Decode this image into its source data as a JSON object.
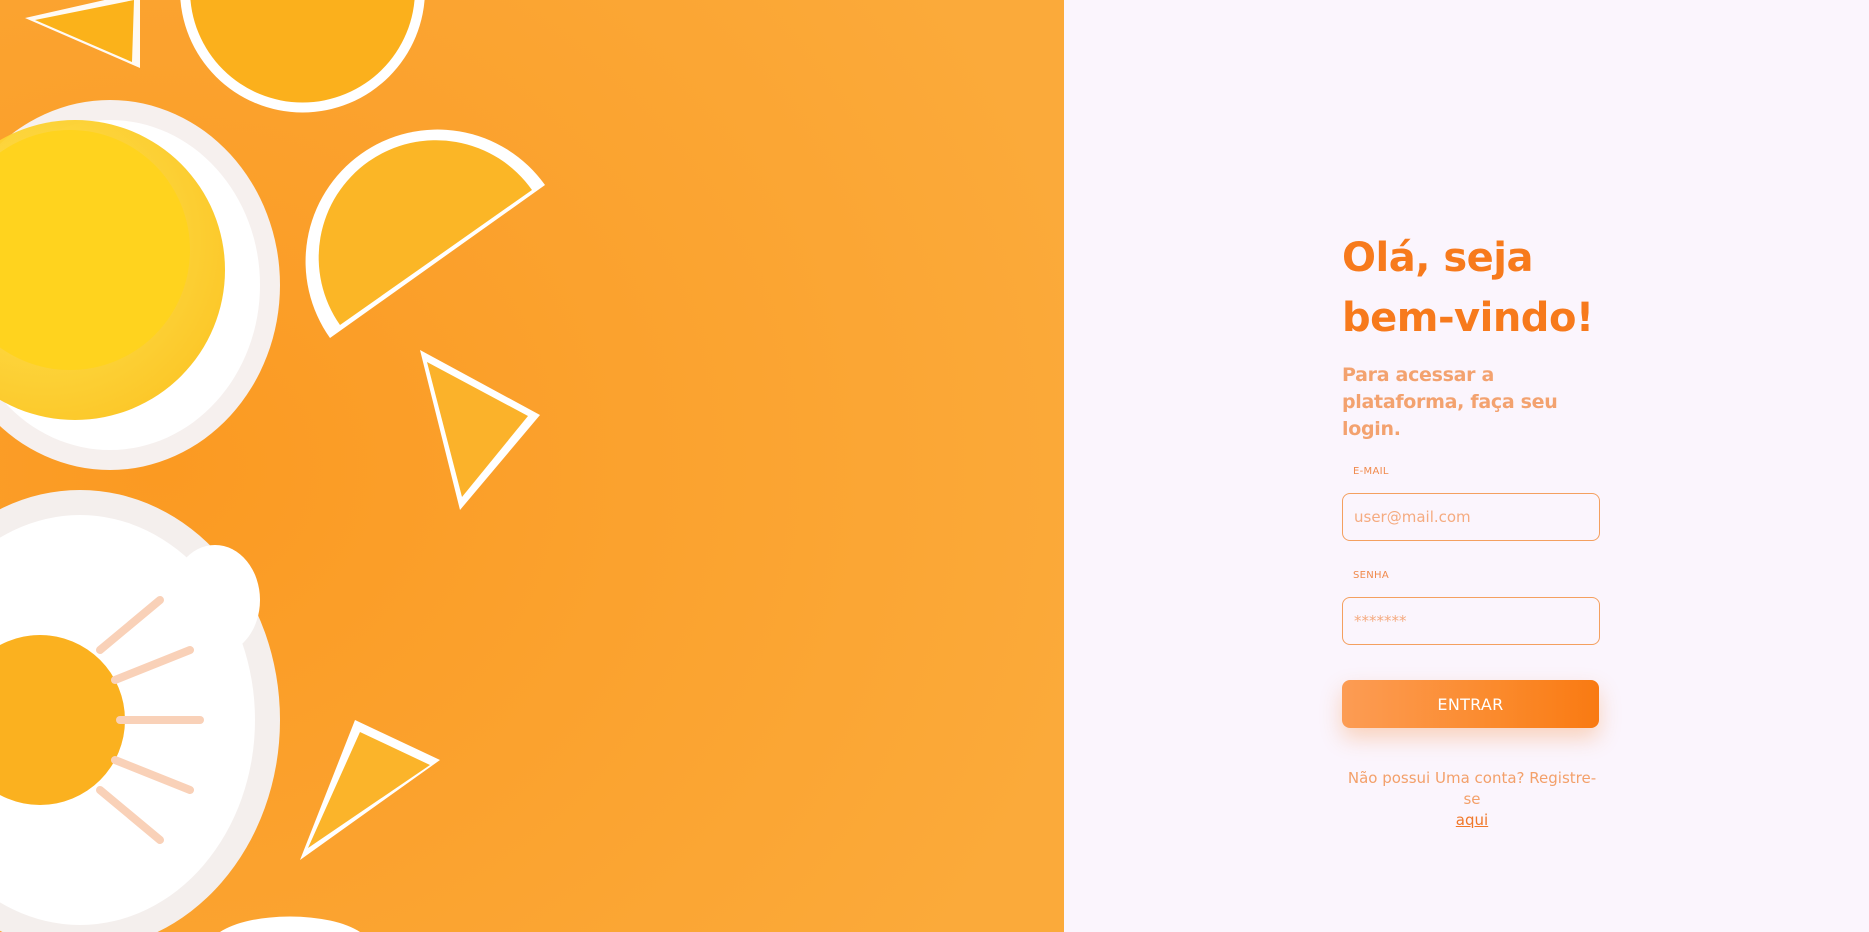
{
  "login": {
    "title": "Olá, seja bem-vindo!",
    "subtitle": "Para acessar a plataforma, faça seu login.",
    "email": {
      "label": "E-MAIL",
      "placeholder": "user@mail.com",
      "value": ""
    },
    "password": {
      "label": "SENHA",
      "placeholder": "*******",
      "value": ""
    },
    "submit_label": "ENTRAR",
    "register_prompt": "Não possui Uma conta? Registre-se",
    "register_link": "aqui"
  },
  "theme": {
    "accent": "#f77a1c",
    "photo_background": "#fba530",
    "page_background": "#fbf5fd"
  }
}
